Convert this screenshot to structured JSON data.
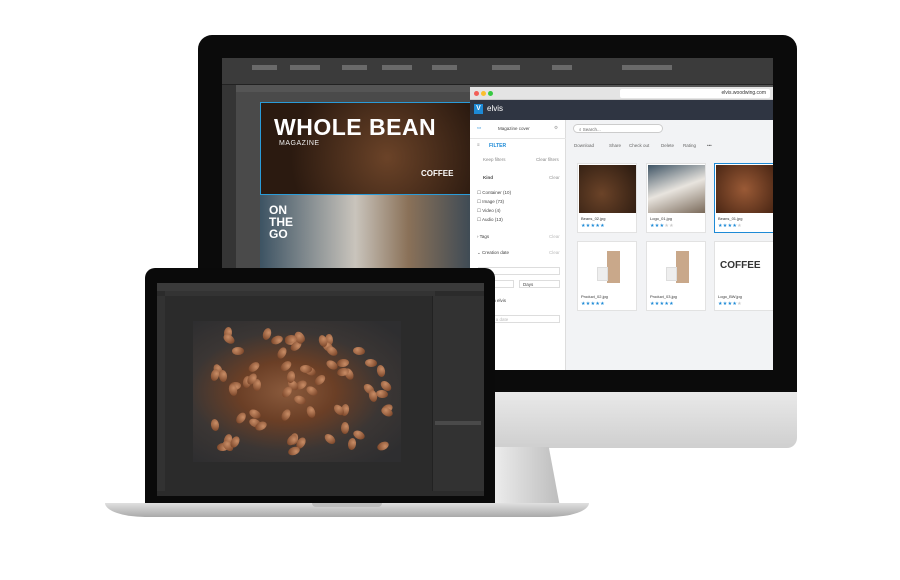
{
  "magazine": {
    "title": "WHOLE BEAN",
    "subtitle": "MAGAZINE",
    "badge": "COFFEE",
    "feature": "ON THE GO"
  },
  "browser": {
    "url": "elvis.woodwing.com"
  },
  "elvis": {
    "app_name": "elvis",
    "logo_letter": "V",
    "accent": "#1d8ad6",
    "folder": "Magazine cover",
    "search_placeholder": "Search...",
    "filter_label": "FILTER",
    "keep_filters": "Keep filters",
    "clear_filters": "Clear filters",
    "kind": {
      "label": "Kind",
      "clear": "Clear",
      "options": [
        "Container (10)",
        "Image (73)",
        "Video (4)",
        "Audio (13)"
      ]
    },
    "tags": {
      "label": "Tags",
      "clear": "Clear"
    },
    "creation_date": {
      "label": "Creation date",
      "clear": "Clear",
      "unit": "Days"
    },
    "added_label": "Added in elvis",
    "date_placeholder": "Select a date",
    "toolbar": [
      "Download",
      "Share",
      "Check out",
      "Delete",
      "Rating",
      "•••"
    ],
    "assets": [
      {
        "name": "Beans_02.jpg",
        "rating": 5,
        "selected": false,
        "kind": "roast"
      },
      {
        "name": "Logo_01.jpg",
        "rating": 3,
        "selected": false,
        "kind": "cup"
      },
      {
        "name": "Beans_01.jpg",
        "rating": 4,
        "selected": true,
        "kind": "beans"
      },
      {
        "name": "Product_02.jpg",
        "rating": 5,
        "selected": false,
        "kind": "product"
      },
      {
        "name": "Product_03.jpg",
        "rating": 5,
        "selected": false,
        "kind": "product"
      },
      {
        "name": "Logo_BW.jpg",
        "rating": 4,
        "selected": false,
        "kind": "logo",
        "logo_text": "COFFEE"
      }
    ]
  }
}
